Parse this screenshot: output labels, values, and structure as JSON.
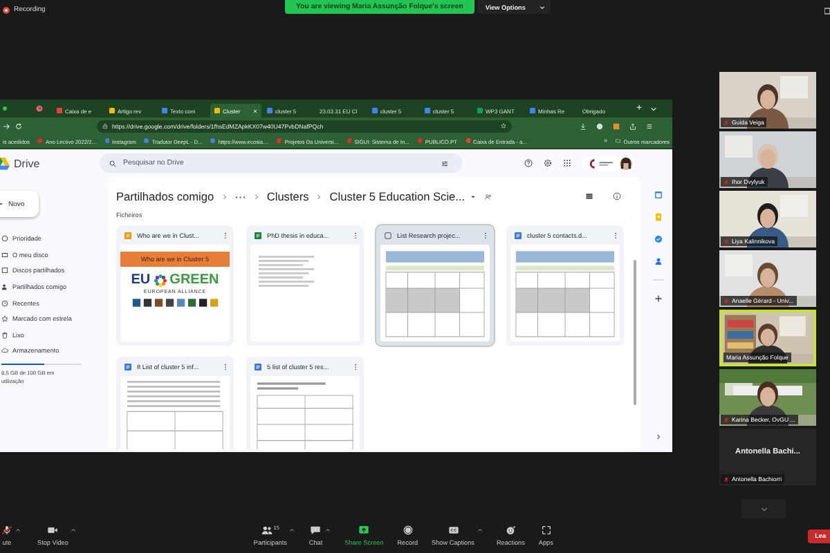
{
  "recording": {
    "label": "Recording"
  },
  "banner": {
    "text": "You are viewing Maria Assunção Folque's screen",
    "view_options": "View Options"
  },
  "browser": {
    "tabs": [
      {
        "label": "Caixa de e",
        "kind": "mail",
        "selected": false
      },
      {
        "label": "Artigo rev",
        "kind": "drive",
        "selected": false
      },
      {
        "label": "Texto com",
        "kind": "doc",
        "selected": false
      },
      {
        "label": "Cluster",
        "kind": "drive",
        "selected": true
      },
      {
        "label": "cluster 5",
        "kind": "doc",
        "selected": false
      },
      {
        "label": "23.03.31 EU Cl",
        "kind": "plain",
        "selected": false
      },
      {
        "label": "cluster 5",
        "kind": "doc",
        "selected": false
      },
      {
        "label": "cluster 5",
        "kind": "doc",
        "selected": false
      },
      {
        "label": "WP3 GANT",
        "kind": "sheet",
        "selected": false
      },
      {
        "label": "Minhas Re",
        "kind": "doc",
        "selected": false
      },
      {
        "label": "Obrigado",
        "kind": "plain",
        "selected": false
      }
    ],
    "new_tab": "+",
    "url": "https://drive.google.com/drive/folders/1fhsEdMZApkKX07w40U47PvbDNafPQch",
    "bookmarks": [
      {
        "label": "is acedidos",
        "kind": "plain"
      },
      {
        "label": "Ano Lectivo 2022/2...",
        "kind": "red"
      },
      {
        "label": "Instagram",
        "kind": "blue"
      },
      {
        "label": "Tradutor DeepL - D...",
        "kind": "blue"
      },
      {
        "label": "https://www.ecosia....",
        "kind": "blue"
      },
      {
        "label": "Projetos Da Universi...",
        "kind": "red"
      },
      {
        "label": "SIGUI: Sistema de In...",
        "kind": "red"
      },
      {
        "label": "PUBLICO.PT",
        "kind": "red"
      },
      {
        "label": "Caixa de Entrada - a...",
        "kind": "mail"
      }
    ],
    "more_bookmarks": "»",
    "other_bookmarks": "Outros marcadores"
  },
  "drive": {
    "logo": "Drive",
    "search_placeholder": "Pesquisar no Drive",
    "new_button": "Novo",
    "nav": [
      {
        "label": "Prioridade",
        "kind": "check"
      },
      {
        "label": "O meu disco",
        "kind": "disk"
      },
      {
        "label": "Discos partilhados",
        "kind": "shared"
      },
      {
        "label": "Partilhados comigo",
        "kind": "person"
      },
      {
        "label": "Recentes",
        "kind": "clock"
      },
      {
        "label": "Marcado com estrela",
        "kind": "star"
      },
      {
        "label": "Lixo",
        "kind": "trash"
      },
      {
        "label": "Armazenamento",
        "kind": "cloud"
      }
    ],
    "storage": {
      "level": 0.53,
      "text": "8,5 GB de 100 GB em utilização"
    },
    "breadcrumb": [
      "Partilhados comigo",
      "···",
      "Clusters",
      "Cluster 5 Education Scie..."
    ],
    "section": "Ficheiros",
    "files": [
      {
        "name": "Who are we in Clust...",
        "kind": "slides",
        "selected": false,
        "thumbnail": {
          "kind": "slide",
          "title": "Who are we in Cluster 5",
          "logo_left": "EU",
          "logo_right": "GREEN",
          "tagline": "EUROPEAN ALLIANCE"
        }
      },
      {
        "name": "PhD thesis in educa...",
        "kind": "sheet",
        "selected": false,
        "thumbnail": {
          "kind": "sheet"
        }
      },
      {
        "name": "List Research projec...",
        "kind": "plain",
        "selected": true,
        "thumbnail": {
          "kind": "table"
        }
      },
      {
        "name": "cluster 5 contacts.d...",
        "kind": "word",
        "selected": false,
        "thumbnail": {
          "kind": "table"
        }
      },
      {
        "name": "8 List of cluster 5 inf...",
        "kind": "word",
        "selected": false,
        "thumbnail": {
          "kind": "text"
        }
      },
      {
        "name": "5 list of cluster 5 res...",
        "kind": "word",
        "selected": false,
        "thumbnail": {
          "kind": "form"
        }
      }
    ]
  },
  "participants": [
    {
      "name": "Guida Veiga",
      "muted": true,
      "speaking": false,
      "kind": "video"
    },
    {
      "name": "Ihor Dvylyuk",
      "muted": true,
      "speaking": false,
      "kind": "video"
    },
    {
      "name": "Liya Kalinnikova",
      "muted": true,
      "speaking": false,
      "kind": "video"
    },
    {
      "name": "Anaelle Gérard - Univ...",
      "muted": true,
      "speaking": false,
      "kind": "video"
    },
    {
      "name": "Maria Assunção Folque",
      "muted": false,
      "speaking": true,
      "kind": "video"
    },
    {
      "name": "Karina Becker, OvGU ...",
      "muted": true,
      "speaking": false,
      "kind": "video"
    },
    {
      "name": "Antonella Bachiorri",
      "muted": true,
      "speaking": false,
      "kind": "name",
      "tile_text": "Antonella Bachi..."
    }
  ],
  "toolbar": [
    {
      "label": "ute",
      "kind": "mic",
      "caret": true,
      "active": false
    },
    {
      "label": "Stop Video",
      "kind": "camera",
      "caret": true,
      "active": false
    },
    {
      "label": "Participants",
      "kind": "people",
      "count": "15",
      "caret": true,
      "active": false
    },
    {
      "label": "Chat",
      "kind": "chat",
      "caret": true,
      "active": false
    },
    {
      "label": "Share Screen",
      "kind": "share",
      "caret": false,
      "active": true
    },
    {
      "label": "Record",
      "kind": "record",
      "caret": false,
      "active": false
    },
    {
      "label": "Show Captions",
      "kind": "cc",
      "caret": true,
      "active": false
    },
    {
      "label": "Reactions",
      "kind": "smile",
      "caret": false,
      "active": false
    },
    {
      "label": "Apps",
      "kind": "apps",
      "caret": false,
      "active": false
    }
  ],
  "leave": "Lea"
}
